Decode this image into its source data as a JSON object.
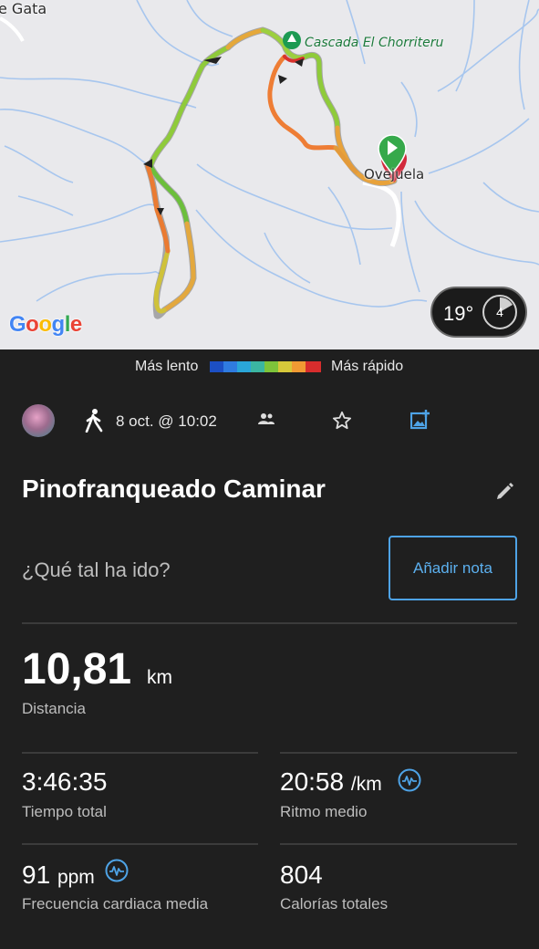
{
  "map": {
    "place_top_left": "e Gata",
    "poi_name": "Cascada El Chorriteru",
    "town_label": "Ovejuela",
    "provider_logo": "Google",
    "weather": {
      "temperature": "19°",
      "indicator": "4"
    }
  },
  "legend": {
    "slow_label": "Más lento",
    "fast_label": "Más rápido"
  },
  "activity": {
    "type_icon": "walk-icon",
    "date_time": "8 oct. @ 10:02",
    "title": "Pinofranqueado Caminar",
    "question": "¿Qué tal ha ido?",
    "add_note_label": "Añadir nota"
  },
  "stats": {
    "distance": {
      "value": "10,81",
      "unit": "km",
      "label": "Distancia"
    },
    "total_time": {
      "value": "3:46:35",
      "label": "Tiempo total"
    },
    "avg_pace": {
      "value": "20:58",
      "unit": "/km",
      "label": "Ritmo medio"
    },
    "avg_hr": {
      "value": "91",
      "unit": "ppm",
      "label": "Frecuencia cardiaca media"
    },
    "calories": {
      "value": "804",
      "label": "Calorías totales"
    }
  },
  "colors": {
    "accent": "#4ea3e6",
    "background": "#1f1f1f",
    "start_marker": "#2ea84a",
    "end_marker": "#d0283a"
  }
}
